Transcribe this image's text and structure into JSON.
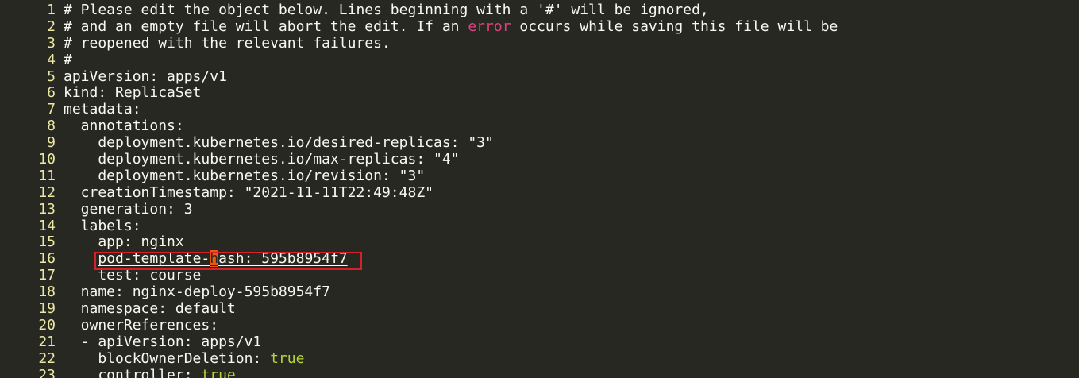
{
  "editor": {
    "lines": [
      {
        "num": "1",
        "text": "# Please edit the object below. Lines beginning with a '#' will be ignored,"
      },
      {
        "num": "2",
        "pre": "# and an empty file will abort the edit. If an ",
        "error_word": "error",
        "post": " occurs while saving this file will be"
      },
      {
        "num": "3",
        "text": "# reopened with the relevant failures."
      },
      {
        "num": "4",
        "text": "#"
      },
      {
        "num": "5",
        "text": "apiVersion: apps/v1"
      },
      {
        "num": "6",
        "text": "kind: ReplicaSet"
      },
      {
        "num": "7",
        "text": "metadata:"
      },
      {
        "num": "8",
        "text": "  annotations:"
      },
      {
        "num": "9",
        "text": "    deployment.kubernetes.io/desired-replicas: \"3\""
      },
      {
        "num": "10",
        "text": "    deployment.kubernetes.io/max-replicas: \"4\""
      },
      {
        "num": "11",
        "text": "    deployment.kubernetes.io/revision: \"3\""
      },
      {
        "num": "12",
        "text": "  creationTimestamp: \"2021-11-11T22:49:48Z\""
      },
      {
        "num": "13",
        "text": "  generation: 3"
      },
      {
        "num": "14",
        "text": "  labels:"
      },
      {
        "num": "15",
        "text": "    app: nginx"
      },
      {
        "num": "16",
        "indent": "    ",
        "pre_cursor": "pod-template-",
        "cursor_char": "h",
        "post_cursor": "ash: 595b8954f7"
      },
      {
        "num": "17",
        "text": "    test: course"
      },
      {
        "num": "18",
        "text": "  name: nginx-deploy-595b8954f7"
      },
      {
        "num": "19",
        "text": "  namespace: default"
      },
      {
        "num": "20",
        "text": "  ownerReferences:"
      },
      {
        "num": "21",
        "text": "  - apiVersion: apps/v1"
      },
      {
        "num": "22",
        "pre": "    blockOwnerDeletion: ",
        "bool": "true"
      },
      {
        "num": "23",
        "pre": "    controller: ",
        "bool": "true"
      }
    ]
  },
  "colors": {
    "background": "#272822",
    "line_number": "#ece9a4",
    "text": "#f8f8f2",
    "error_keyword": "#e0407e",
    "boolean": "#b6d33a",
    "cursor": "#e85a10",
    "highlight_border": "#d4212a"
  }
}
